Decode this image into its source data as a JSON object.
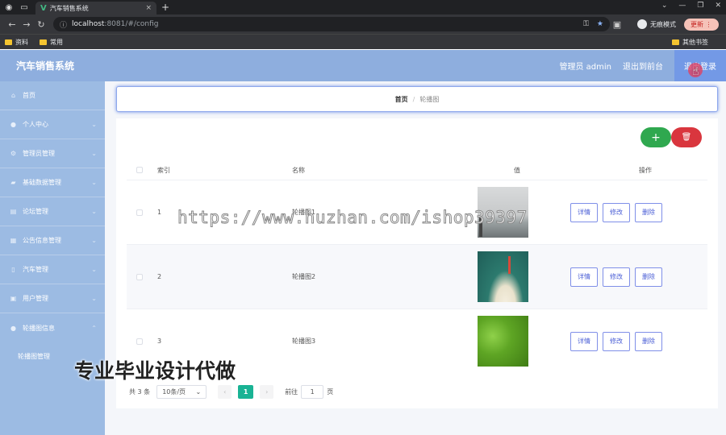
{
  "browser": {
    "tab_title": "汽车销售系统",
    "tab_close": "×",
    "new_tab": "+",
    "url_host": "localhost",
    "url_rest": ":8081/#/config",
    "incognito_label": "无痕模式",
    "update_label": "更新",
    "bookmarks": [
      {
        "label": "资料"
      },
      {
        "label": "常用"
      }
    ],
    "bookmarks_right": "其他书签"
  },
  "header": {
    "app_title": "汽车销售系统",
    "admin_label": "管理员 admin",
    "backstage_label": "退出到前台",
    "logout_label": "退出登录"
  },
  "sidebar": {
    "items": [
      {
        "label": "首页",
        "icon": "home-icon",
        "glyph": "⌂"
      },
      {
        "label": "个人中心",
        "icon": "user-icon",
        "glyph": "●"
      },
      {
        "label": "管理员管理",
        "icon": "gear-icon",
        "glyph": "⚙"
      },
      {
        "label": "基础数据管理",
        "icon": "folder-icon",
        "glyph": "▰"
      },
      {
        "label": "论坛管理",
        "icon": "chat-icon",
        "glyph": "▤"
      },
      {
        "label": "公告信息管理",
        "icon": "notice-icon",
        "glyph": "▦"
      },
      {
        "label": "汽车管理",
        "icon": "car-icon",
        "glyph": "▯"
      },
      {
        "label": "用户管理",
        "icon": "users-icon",
        "glyph": "▣"
      },
      {
        "label": "轮播图信息",
        "icon": "picture-icon",
        "glyph": "●"
      }
    ],
    "sub_item": "轮播图管理"
  },
  "breadcrumb": {
    "home": "首页",
    "separator": "/",
    "current": "轮播图"
  },
  "toolbar": {
    "add_glyph": "+",
    "delete_glyph": "🗑"
  },
  "table": {
    "headers": {
      "index": "索引",
      "name": "名称",
      "value": "值",
      "ops": "操作"
    },
    "rows": [
      {
        "index": "1",
        "name": "轮播图1"
      },
      {
        "index": "2",
        "name": "轮播图2"
      },
      {
        "index": "3",
        "name": "轮播图3"
      }
    ],
    "ops": {
      "detail": "详情",
      "edit": "修改",
      "delete": "删除"
    }
  },
  "pager": {
    "total": "共 3 条",
    "page_size": "10条/页",
    "prev": "‹",
    "current": "1",
    "next": "›",
    "goto_label": "前往",
    "goto_value": "1",
    "page_suffix": "页"
  },
  "overlay": {
    "watermark": "https://www.huzhan.com/ishop39397",
    "promo": "专业毕业设计代做"
  },
  "colors": {
    "header_bg": "#8eaede",
    "sidebar_bg": "#9cbbe3",
    "add_btn": "#2fa84f",
    "delete_btn": "#d9363e",
    "pager_active": "#19b394"
  }
}
